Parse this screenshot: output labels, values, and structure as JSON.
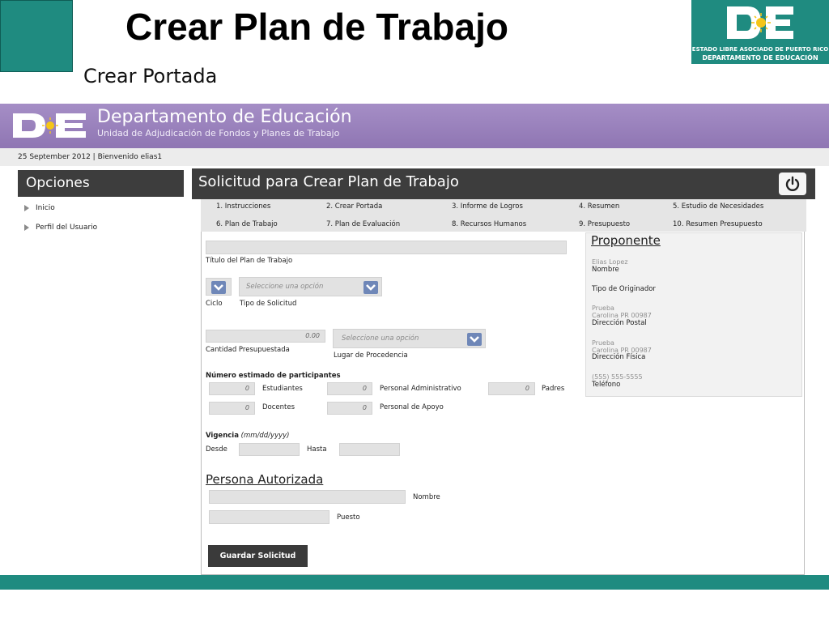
{
  "slide": {
    "title": "Crear Plan de Trabajo",
    "subtitle": "Crear Portada"
  },
  "logo": {
    "line1": "ESTADO LIBRE ASOCIADO DE PUERTO RICO",
    "line2": "DEPARTAMENTO DE EDUCACIÓN"
  },
  "banner": {
    "title": "Departamento de Educación",
    "subtitle": "Unidad de Adjudicación de Fondos y Planes de Trabajo",
    "date_line": "25 September 2012 | Bienvenido elias1"
  },
  "sidebar": {
    "header": "Opciones",
    "items": [
      {
        "label": "Inicio"
      },
      {
        "label": "Perfil del Usuario"
      }
    ]
  },
  "main": {
    "title": "Solicitud para Crear Plan de Trabajo",
    "steps": [
      "1. Instrucciones",
      "2. Crear Portada",
      "3. Informe de Logros",
      "4. Resumen",
      "5. Estudio de Necesidades",
      "6. Plan de Trabajo",
      "7. Plan de Evaluación",
      "8. Recursos Humanos",
      "9. Presupuesto",
      "10. Resumen Presupuesto"
    ]
  },
  "form": {
    "titulo_label": "Título del Plan de Trabajo",
    "ciclo_label": "Ciclo",
    "tipo_label": "Tipo de Solicitud",
    "select_placeholder": "Seleccione una opción",
    "cantidad_value": "0.00",
    "cantidad_label": "Cantidad Presupuestada",
    "lugar_label": "Lugar de Procedencia",
    "participantes_heading": "Número estimado de participantes",
    "estudiantes_label": "Estudiantes",
    "estudiantes_value": "0",
    "admin_label": "Personal Administrativo",
    "admin_value": "0",
    "padres_label": "Padres",
    "padres_value": "0",
    "docentes_label": "Docentes",
    "docentes_value": "0",
    "apoyo_label": "Personal de Apoyo",
    "apoyo_value": "0",
    "vigencia_label": "Vigencia",
    "vigencia_format": "(mm/dd/yyyy)",
    "desde_label": "Desde",
    "hasta_label": "Hasta",
    "persona_heading": "Persona Autorizada",
    "nombre_label": "Nombre",
    "puesto_label": "Puesto",
    "save_label": "Guardar Solicitud"
  },
  "proponente": {
    "heading": "Proponente",
    "nombre_value": "Elias Lopez",
    "nombre_label": "Nombre",
    "tipo_label": "Tipo de Originador",
    "postal_line1": "Prueba",
    "postal_line2": "Carolina PR 00987",
    "postal_label": "Dirección Postal",
    "fisica_line1": "Prueba",
    "fisica_line2": "Carolina PR 00987",
    "fisica_label": "Dirección Física",
    "telefono_value": "(555) 555-5555",
    "telefono_label": "Teléfono"
  }
}
